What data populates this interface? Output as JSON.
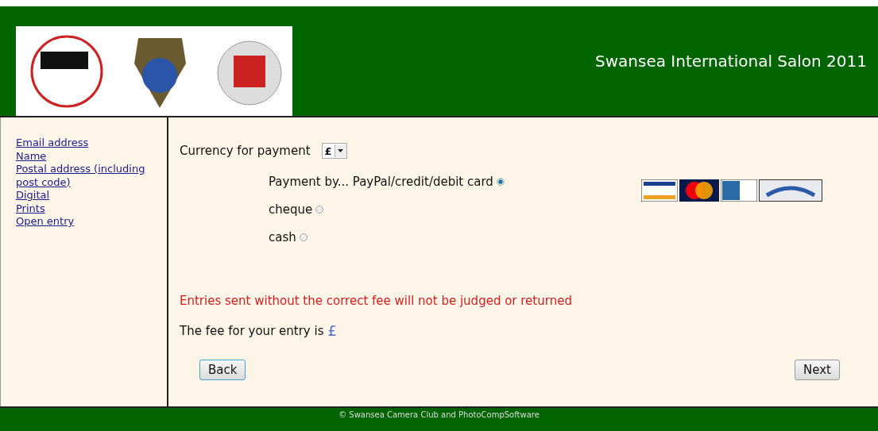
{
  "header": {
    "title": "Swansea International Salon 2011"
  },
  "sidebar": {
    "links": [
      "Email address",
      "Name",
      "Postal address (including post code)",
      "Digital",
      "Prints",
      "Open entry"
    ]
  },
  "currency": {
    "label": "Currency for payment",
    "value": "£"
  },
  "payment_options": [
    {
      "label": "Payment by... PayPal/credit/debit card",
      "selected": true
    },
    {
      "label": "cheque",
      "selected": false
    },
    {
      "label": "cash",
      "selected": false
    }
  ],
  "warning": "Entries sent without the correct fee will not be judged or returned",
  "fee": {
    "label": "The fee for your entry is",
    "value": "£"
  },
  "buttons": {
    "back": "Back",
    "next": "Next"
  },
  "footer": "© Swansea Camera Club  and PhotoCompSoftware"
}
